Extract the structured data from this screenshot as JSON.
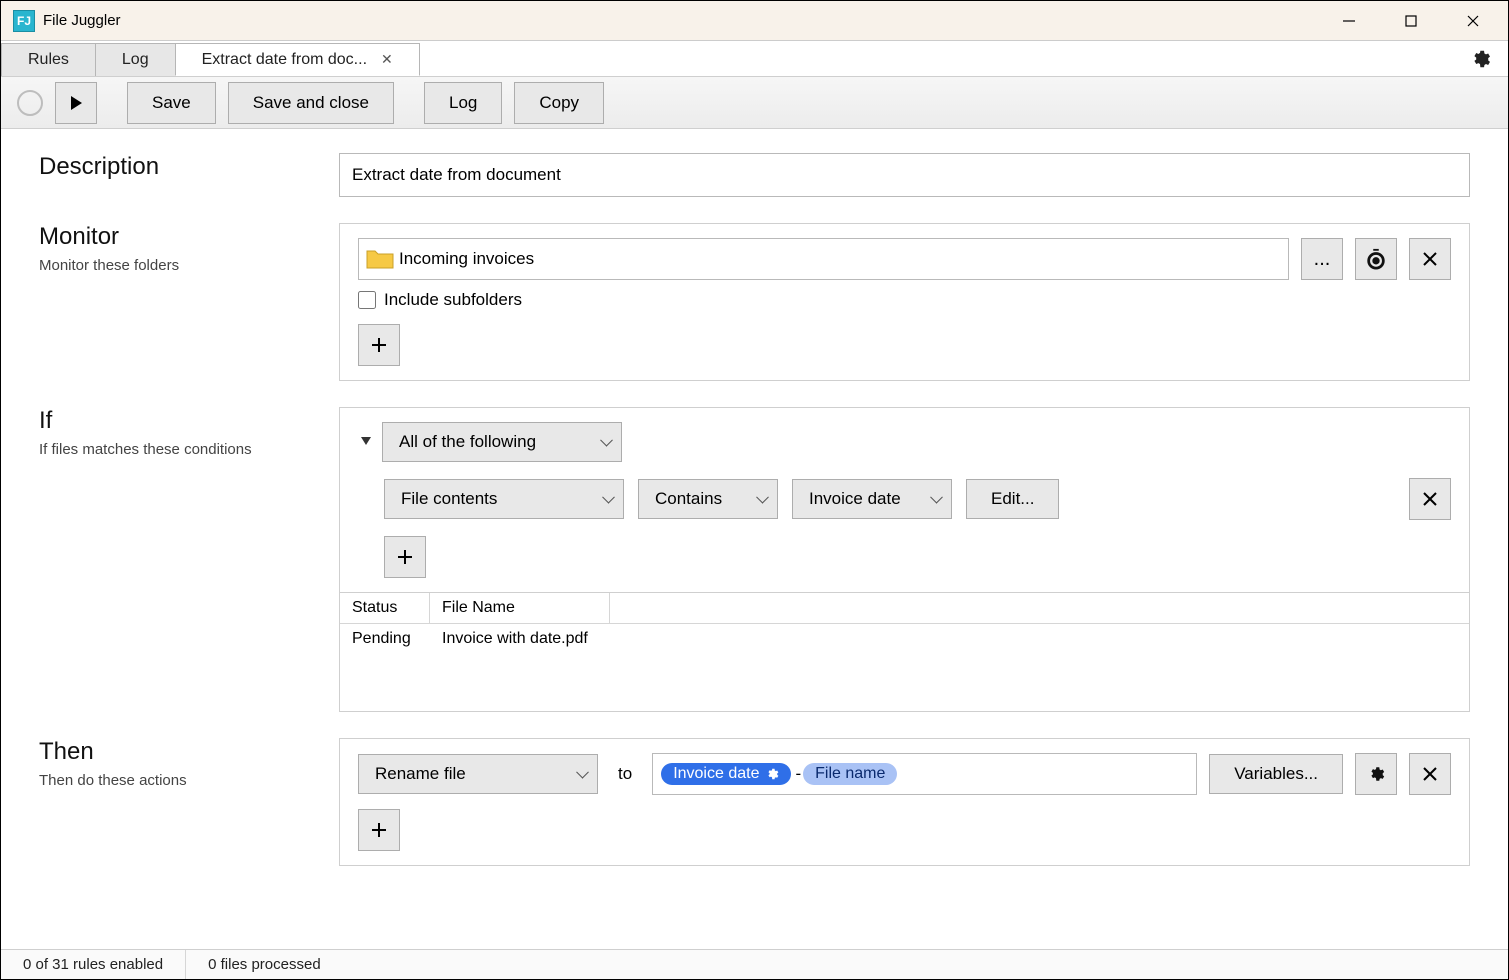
{
  "app": {
    "title": "File Juggler"
  },
  "tabs": {
    "rules": "Rules",
    "log": "Log",
    "current": "Extract date from doc..."
  },
  "toolbar": {
    "save": "Save",
    "save_close": "Save and close",
    "log": "Log",
    "copy": "Copy"
  },
  "description": {
    "label": "Description",
    "value": "Extract date from document"
  },
  "monitor": {
    "label": "Monitor",
    "sub": "Monitor these folders",
    "folder": "Incoming invoices",
    "browse": "...",
    "include_sub": "Include subfolders"
  },
  "if": {
    "label": "If",
    "sub": "If files matches these conditions",
    "group": "All of the following",
    "field": "File contents",
    "op": "Contains",
    "value": "Invoice date",
    "edit": "Edit...",
    "table": {
      "cols": [
        "Status",
        "File Name"
      ],
      "rows": [
        {
          "status": "Pending",
          "name": "Invoice with date.pdf"
        }
      ]
    }
  },
  "then": {
    "label": "Then",
    "sub": "Then do these actions",
    "action": "Rename file",
    "to": "to",
    "token1": "Invoice date",
    "sep": "-",
    "token2": "File name",
    "variables": "Variables..."
  },
  "status": {
    "rules": "0 of 31 rules enabled",
    "files": "0 files processed"
  }
}
